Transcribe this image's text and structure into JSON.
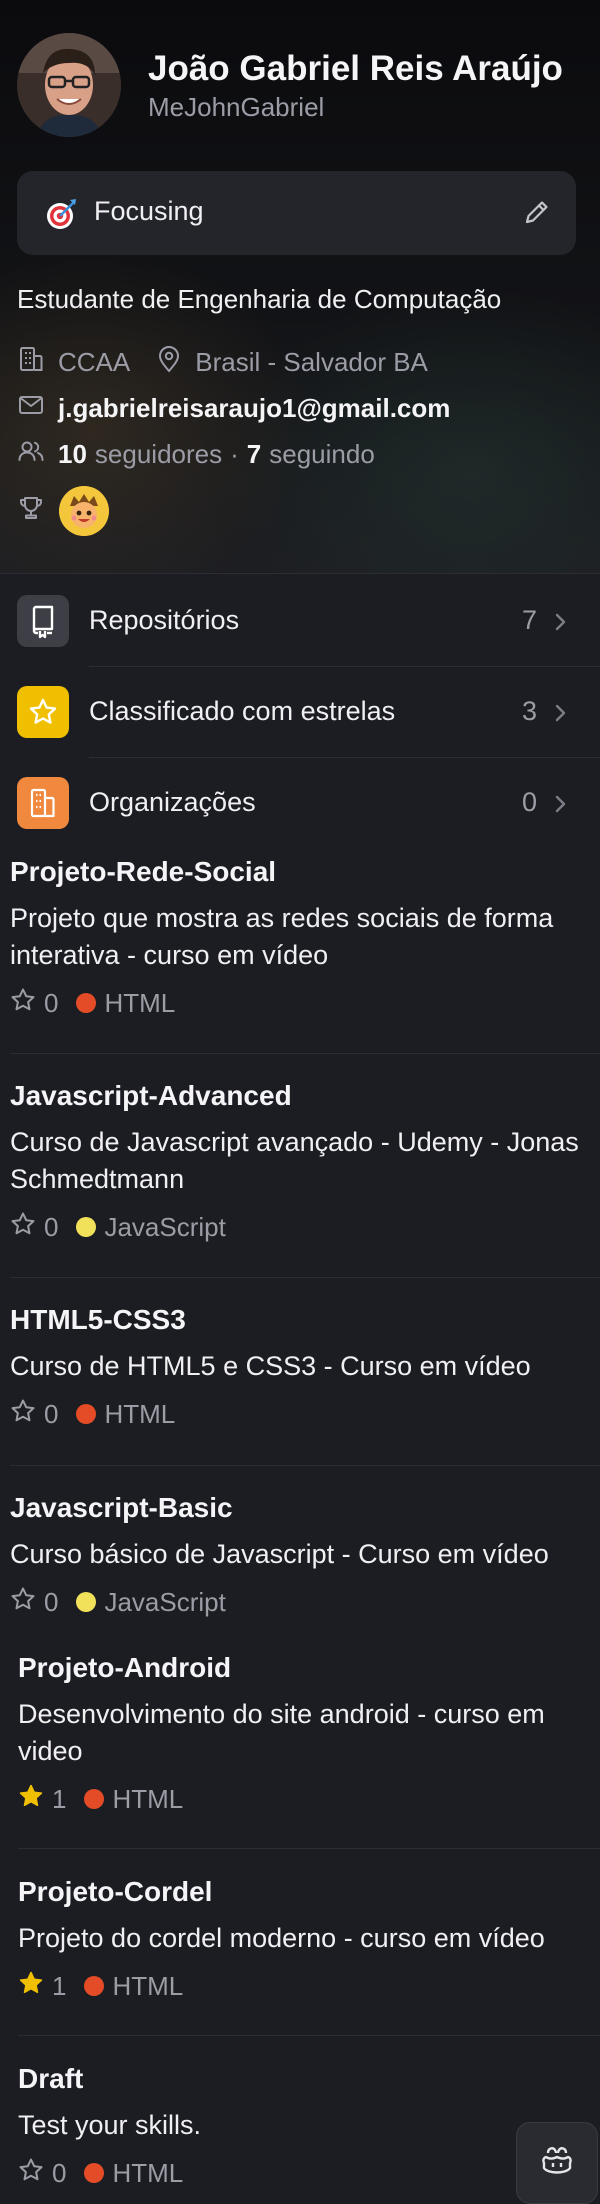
{
  "profile": {
    "name": "João Gabriel Reis Araújo",
    "username": "MeJohnGabriel",
    "status": {
      "emoji": "dart-emoji",
      "text": "Focusing"
    },
    "bio": "Estudante de Engenharia de Computação",
    "company": "CCAA",
    "location": "Brasil - Salvador BA",
    "email": "j.gabrielreisaraujo1@gmail.com",
    "followers_count": "10",
    "followers_label": "seguidores",
    "separator": "·",
    "following_count": "7",
    "following_label": "seguindo"
  },
  "menu": [
    {
      "label": "Repositórios",
      "count": "7",
      "icon": "repo-icon",
      "color": "#3d3e46"
    },
    {
      "label": "Classificado com estrelas",
      "count": "3",
      "icon": "star-icon",
      "color": "#f0c000"
    },
    {
      "label": "Organizações",
      "count": "0",
      "icon": "organization-icon",
      "color": "#f0883e"
    }
  ],
  "repos": [
    {
      "name": "Projeto-Rede-Social",
      "description": "Projeto que mostra as redes sociais de forma interativa - curso em vídeo",
      "stars": "0",
      "starred": false,
      "language": "HTML",
      "lang_color": "#e34c26"
    },
    {
      "name": "Javascript-Advanced",
      "description": "Curso de Javascript avançado - Udemy - Jonas Schmedtmann",
      "stars": "0",
      "starred": false,
      "language": "JavaScript",
      "lang_color": "#f1e05a"
    },
    {
      "name": "HTML5-CSS3",
      "description": "Curso de HTML5 e CSS3 - Curso em vídeo",
      "stars": "0",
      "starred": false,
      "language": "HTML",
      "lang_color": "#e34c26"
    },
    {
      "name": "Javascript-Basic",
      "description": "Curso básico de Javascript - Curso em vídeo",
      "stars": "0",
      "starred": false,
      "language": "JavaScript",
      "lang_color": "#f1e05a"
    },
    {
      "name": "Projeto-Android",
      "description": "Desenvolvimento do site android - curso em video",
      "stars": "1",
      "starred": true,
      "language": "HTML",
      "lang_color": "#e34c26"
    },
    {
      "name": "Projeto-Cordel",
      "description": "Projeto do cordel moderno - curso em vídeo",
      "stars": "1",
      "starred": true,
      "language": "HTML",
      "lang_color": "#e34c26"
    },
    {
      "name": "Draft",
      "description": "Test your skills.",
      "stars": "0",
      "starred": false,
      "language": "HTML",
      "lang_color": "#e34c26"
    }
  ],
  "copilot": {
    "icon": "copilot-icon"
  }
}
